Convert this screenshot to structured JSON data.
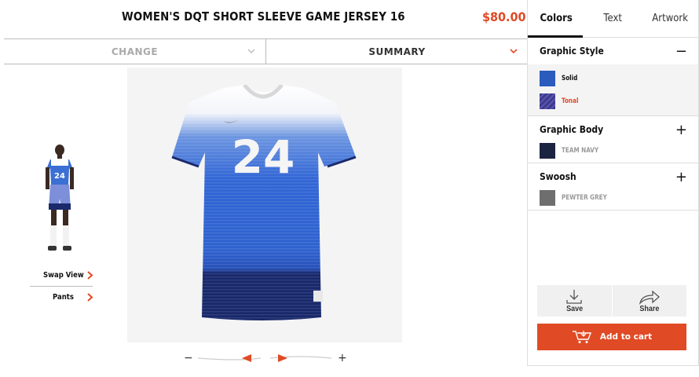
{
  "product": {
    "title": "WOMEN'S DQT SHORT SLEEVE GAME JERSEY 16",
    "price": "$80.00",
    "number": "24"
  },
  "selector_bar": {
    "change_label": "CHANGE",
    "summary_label": "SUMMARY"
  },
  "mini_view": {
    "swap_view_label": "Swap View",
    "pants_label": "Pants",
    "number": "24"
  },
  "panel": {
    "tabs": [
      {
        "label": "Colors",
        "active": true
      },
      {
        "label": "Text",
        "active": false
      },
      {
        "label": "Artwork",
        "active": false
      }
    ],
    "sections": [
      {
        "title": "Graphic Style",
        "toggle": "−",
        "expanded": true,
        "options": [
          {
            "label": "Solid",
            "color": "#2a5bbd",
            "selected": false
          },
          {
            "label": "Tonal",
            "color": "#3d3a8a",
            "selected": true
          }
        ]
      },
      {
        "title": "Graphic Body",
        "toggle": "+",
        "expanded": false,
        "current": {
          "label": "TEAM NAVY",
          "color": "#1b2440"
        }
      },
      {
        "title": "Swoosh",
        "toggle": "+",
        "expanded": false,
        "current": {
          "label": "PEWTER GREY",
          "color": "#6e6e6e"
        }
      }
    ],
    "actions": {
      "save_label": "Save",
      "share_label": "Share",
      "cart_label": "Add to cart"
    }
  },
  "zoom": {
    "minus": "−",
    "plus": "+"
  },
  "colors": {
    "accent": "#e04a25",
    "jersey_blue": "#2f68d6",
    "jersey_navy": "#1b2a6b"
  }
}
